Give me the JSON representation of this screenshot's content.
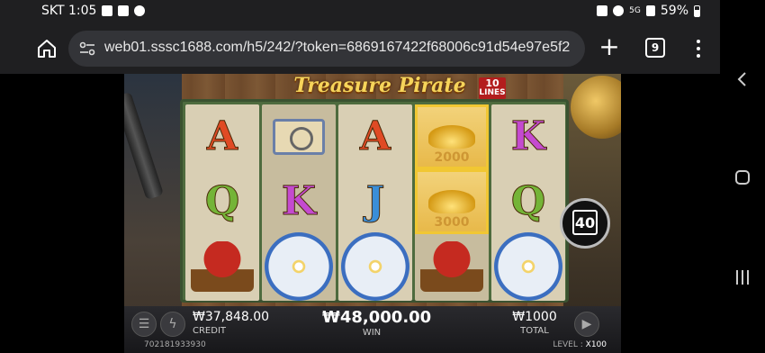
{
  "status_bar": {
    "carrier_time": "SKT 1:05",
    "network": "5G",
    "battery": "59%"
  },
  "browser": {
    "url": "web01.sssc1688.com/h5/242/?token=6869167422f68006c91d54e97e5f2",
    "tab_count": "9"
  },
  "game": {
    "title": "Treasure Pirate",
    "lines_badge_number": "10",
    "lines_badge_label": "LINES",
    "lines_button_value": "40",
    "reels": [
      [
        "A",
        "Q",
        "ship"
      ],
      [
        "map",
        "K",
        "compass"
      ],
      [
        "A",
        "J",
        "compass"
      ],
      [
        "gold",
        "gold",
        "ship"
      ],
      [
        "K",
        "Q",
        "compass"
      ]
    ],
    "gold_values": [
      "2000",
      "3000"
    ],
    "credit_amount": "₩37,848.00",
    "credit_label": "CREDIT",
    "win_amount": "₩48,000.00",
    "win_label": "WIN",
    "total_amount": "₩1000",
    "total_label": "TOTAL",
    "game_id": "702181933930",
    "level_label": "LEVEL :",
    "level_value": "X100"
  },
  "colors": {
    "accent_gold": "#f6d45a",
    "letter_A": "#e04a24",
    "letter_Q": "#74b437",
    "letter_K": "#c44ad0",
    "letter_J": "#3a8ed8"
  }
}
